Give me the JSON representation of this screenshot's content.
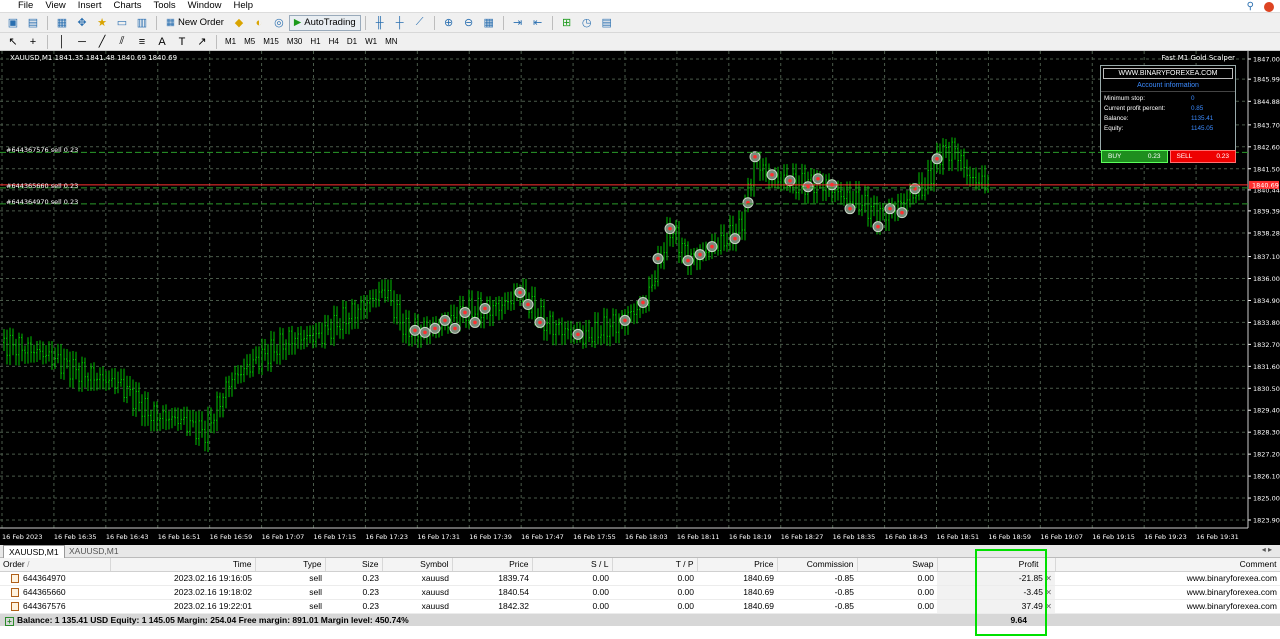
{
  "menu": {
    "items": [
      "File",
      "View",
      "Insert",
      "Charts",
      "Tools",
      "Window",
      "Help"
    ]
  },
  "toolbar": {
    "new_order_label": "New Order",
    "autotrading_label": "AutoTrading"
  },
  "timeframes": [
    "M1",
    "M5",
    "M15",
    "M30",
    "H1",
    "H4",
    "D1",
    "W1",
    "MN"
  ],
  "chart": {
    "symbol_label": "XAUUSD,M1  1841.35 1841.48 1840.69 1840.69",
    "ea_label": "Fast M1 Gold Scalper",
    "order_lines": [
      {
        "label": "#644367576  sell 0.23",
        "price": 1842.32
      },
      {
        "label": "#644365660  sell 0.23",
        "price": 1840.54
      },
      {
        "label": "#644364970  sell 0.23",
        "price": 1839.74
      }
    ],
    "current_price": "1840.69",
    "price_ticks": [
      "1847.00",
      "1845.99",
      "1844.88",
      "1843.70",
      "1842.60",
      "1841.50",
      "1840.44",
      "1839.39",
      "1838.28",
      "1837.10",
      "1836.00",
      "1834.90",
      "1833.80",
      "1832.70",
      "1831.60",
      "1830.50",
      "1829.40",
      "1828.30",
      "1827.20",
      "1826.10",
      "1825.00",
      "1823.90"
    ],
    "time_ticks": [
      "16 Feb 2023",
      "16 Feb 16:35",
      "16 Feb 16:43",
      "16 Feb 16:51",
      "16 Feb 16:59",
      "16 Feb 17:07",
      "16 Feb 17:15",
      "16 Feb 17:23",
      "16 Feb 17:31",
      "16 Feb 17:39",
      "16 Feb 17:47",
      "16 Feb 17:55",
      "16 Feb 18:03",
      "16 Feb 18:11",
      "16 Feb 18:19",
      "16 Feb 18:27",
      "16 Feb 18:35",
      "16 Feb 18:43",
      "16 Feb 18:51",
      "16 Feb 18:59",
      "16 Feb 19:07",
      "16 Feb 19:15",
      "16 Feb 19:23",
      "16 Feb 19:31"
    ],
    "colors": {
      "bull": "#00c000",
      "bear": "#00c000",
      "grid": "#4a5a4a",
      "order_line": "#2a9a2a",
      "bid_line": "#ff3030"
    }
  },
  "info_panel": {
    "site": "WWW.BINARYFOREXEA.COM",
    "header": "Account information",
    "rows": [
      {
        "label": "Minimum stop:",
        "value": "0"
      },
      {
        "label": "Current profit percent:",
        "value": "0.85"
      },
      {
        "label": "Balance:",
        "value": "1135.41"
      },
      {
        "label": "Equity:",
        "value": "1145.05"
      }
    ],
    "buy_label": "BUY",
    "buy_lots": "0.23",
    "sell_label": "SELL",
    "sell_lots": "0.23"
  },
  "tabs": [
    "XAUUSD,M1",
    "XAUUSD,M1"
  ],
  "terminal": {
    "columns": [
      "Order",
      "Time",
      "Type",
      "Size",
      "Symbol",
      "Price",
      "S / L",
      "T / P",
      "Price",
      "Commission",
      "Swap",
      "Profit",
      "Comment"
    ],
    "rows": [
      {
        "order": "644364970",
        "time": "2023.02.16 19:16:05",
        "type": "sell",
        "size": "0.23",
        "symbol": "xauusd",
        "price": "1839.74",
        "sl": "0.00",
        "tp": "0.00",
        "cur_price": "1840.69",
        "commission": "-0.85",
        "swap": "0.00",
        "profit": "-21.85",
        "comment": "www.binaryforexea.com"
      },
      {
        "order": "644365660",
        "time": "2023.02.16 19:18:02",
        "type": "sell",
        "size": "0.23",
        "symbol": "xauusd",
        "price": "1840.54",
        "sl": "0.00",
        "tp": "0.00",
        "cur_price": "1840.69",
        "commission": "-0.85",
        "swap": "0.00",
        "profit": "-3.45",
        "comment": "www.binaryforexea.com"
      },
      {
        "order": "644367576",
        "time": "2023.02.16 19:22:01",
        "type": "sell",
        "size": "0.23",
        "symbol": "xauusd",
        "price": "1842.32",
        "sl": "0.00",
        "tp": "0.00",
        "cur_price": "1840.69",
        "commission": "-0.85",
        "swap": "0.00",
        "profit": "37.49",
        "comment": "www.binaryforexea.com"
      }
    ],
    "balance_text": "Balance: 1 135.41 USD  Equity: 1 145.05  Margin: 254.04  Free margin: 891.01  Margin level: 450.74%",
    "total_profit": "9.64"
  }
}
